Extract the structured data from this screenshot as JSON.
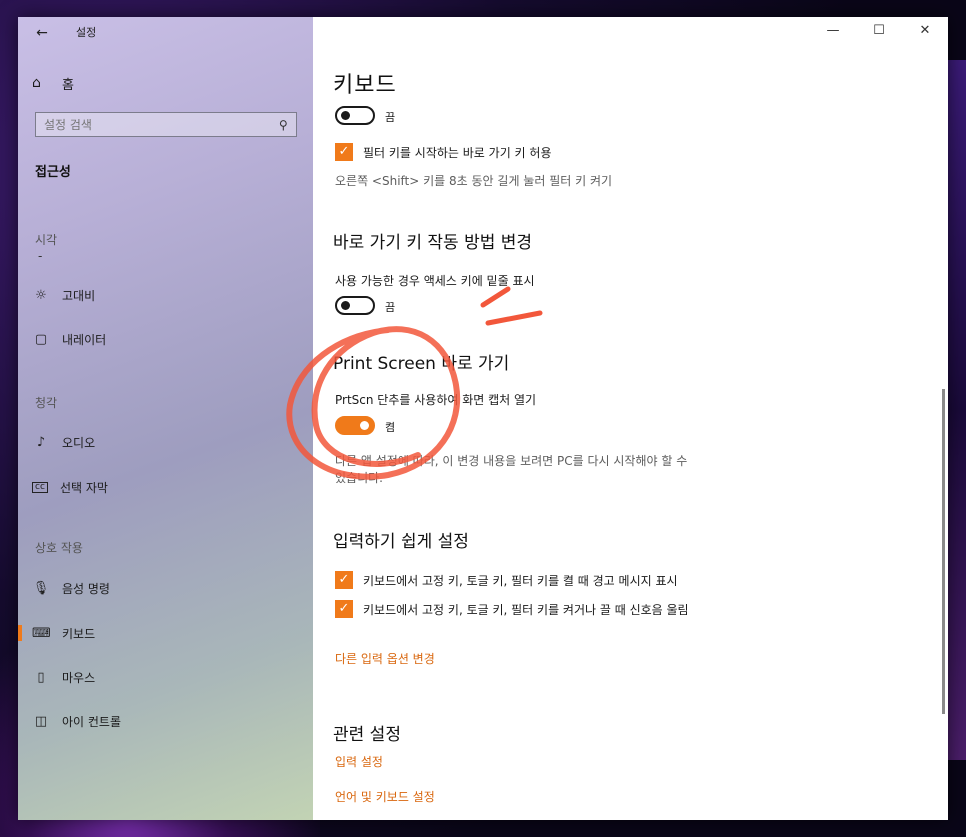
{
  "window": {
    "title": "설정",
    "back_glyph": "←",
    "minimize_glyph": "—",
    "maximize_glyph": "☐",
    "close_glyph": "✕"
  },
  "sidebar": {
    "home_label": "홈",
    "search_placeholder": "설정 검색",
    "category": "접근성",
    "groups": {
      "vision": "시각",
      "vision_dash": "-",
      "hearing": "청각",
      "interaction": "상호 작용"
    },
    "items": [
      {
        "label": "고대비",
        "icon": "sun-icon"
      },
      {
        "label": "내레이터",
        "icon": "narrator-icon"
      },
      {
        "label": "오디오",
        "icon": "speaker-icon"
      },
      {
        "label": "선택 자막",
        "icon": "cc-icon"
      },
      {
        "label": "음성 명령",
        "icon": "microphone-icon"
      },
      {
        "label": "키보드",
        "icon": "keyboard-icon",
        "active": true
      },
      {
        "label": "마우스",
        "icon": "mouse-icon"
      },
      {
        "label": "아이 컨트롤",
        "icon": "eye-control-icon"
      }
    ]
  },
  "main": {
    "keyboard_heading": "키보드",
    "filter_toggle_state": "끔",
    "filter_shortcut_check": "필터 키를 시작하는 바로 가기 키 허용",
    "filter_shortcut_desc": "오른쪽 <Shift> 키를 8초 동안 길게 눌러 필터 키 켜기",
    "shortcut_heading": "바로 가기 키 작동 방법 변경",
    "underline_label": "사용 가능한 경우 액세스 키에 밑줄 표시",
    "underline_toggle_state": "끔",
    "print_heading": "Print Screen 바로 가기",
    "prtscn_label": "PrtScn 단추를 사용하여 화면 캡처 열기",
    "prtscn_toggle_state": "켬",
    "restart_desc_line1": "다른 앱 설정에 따라, 이 변경 내용을 보려면 PC를 다시 시작해야 할 수",
    "restart_desc_line2": "있습니다.",
    "typing_heading": "입력하기 쉽게 설정",
    "typing_check1": "키보드에서 고정 키, 토글 키, 필터 키를 켤 때 경고 메시지 표시",
    "typing_check2": "키보드에서 고정 키, 토글 키, 필터 키를 켜거나 끌 때 신호음 울림",
    "other_input_link": "다른 입력 옵션 변경",
    "related_heading": "관련 설정",
    "related_link1": "입력 설정",
    "related_link2": "언어 및 키보드 설정"
  },
  "colors": {
    "accent": "#f07a1a",
    "annotation": "#f2573b"
  }
}
